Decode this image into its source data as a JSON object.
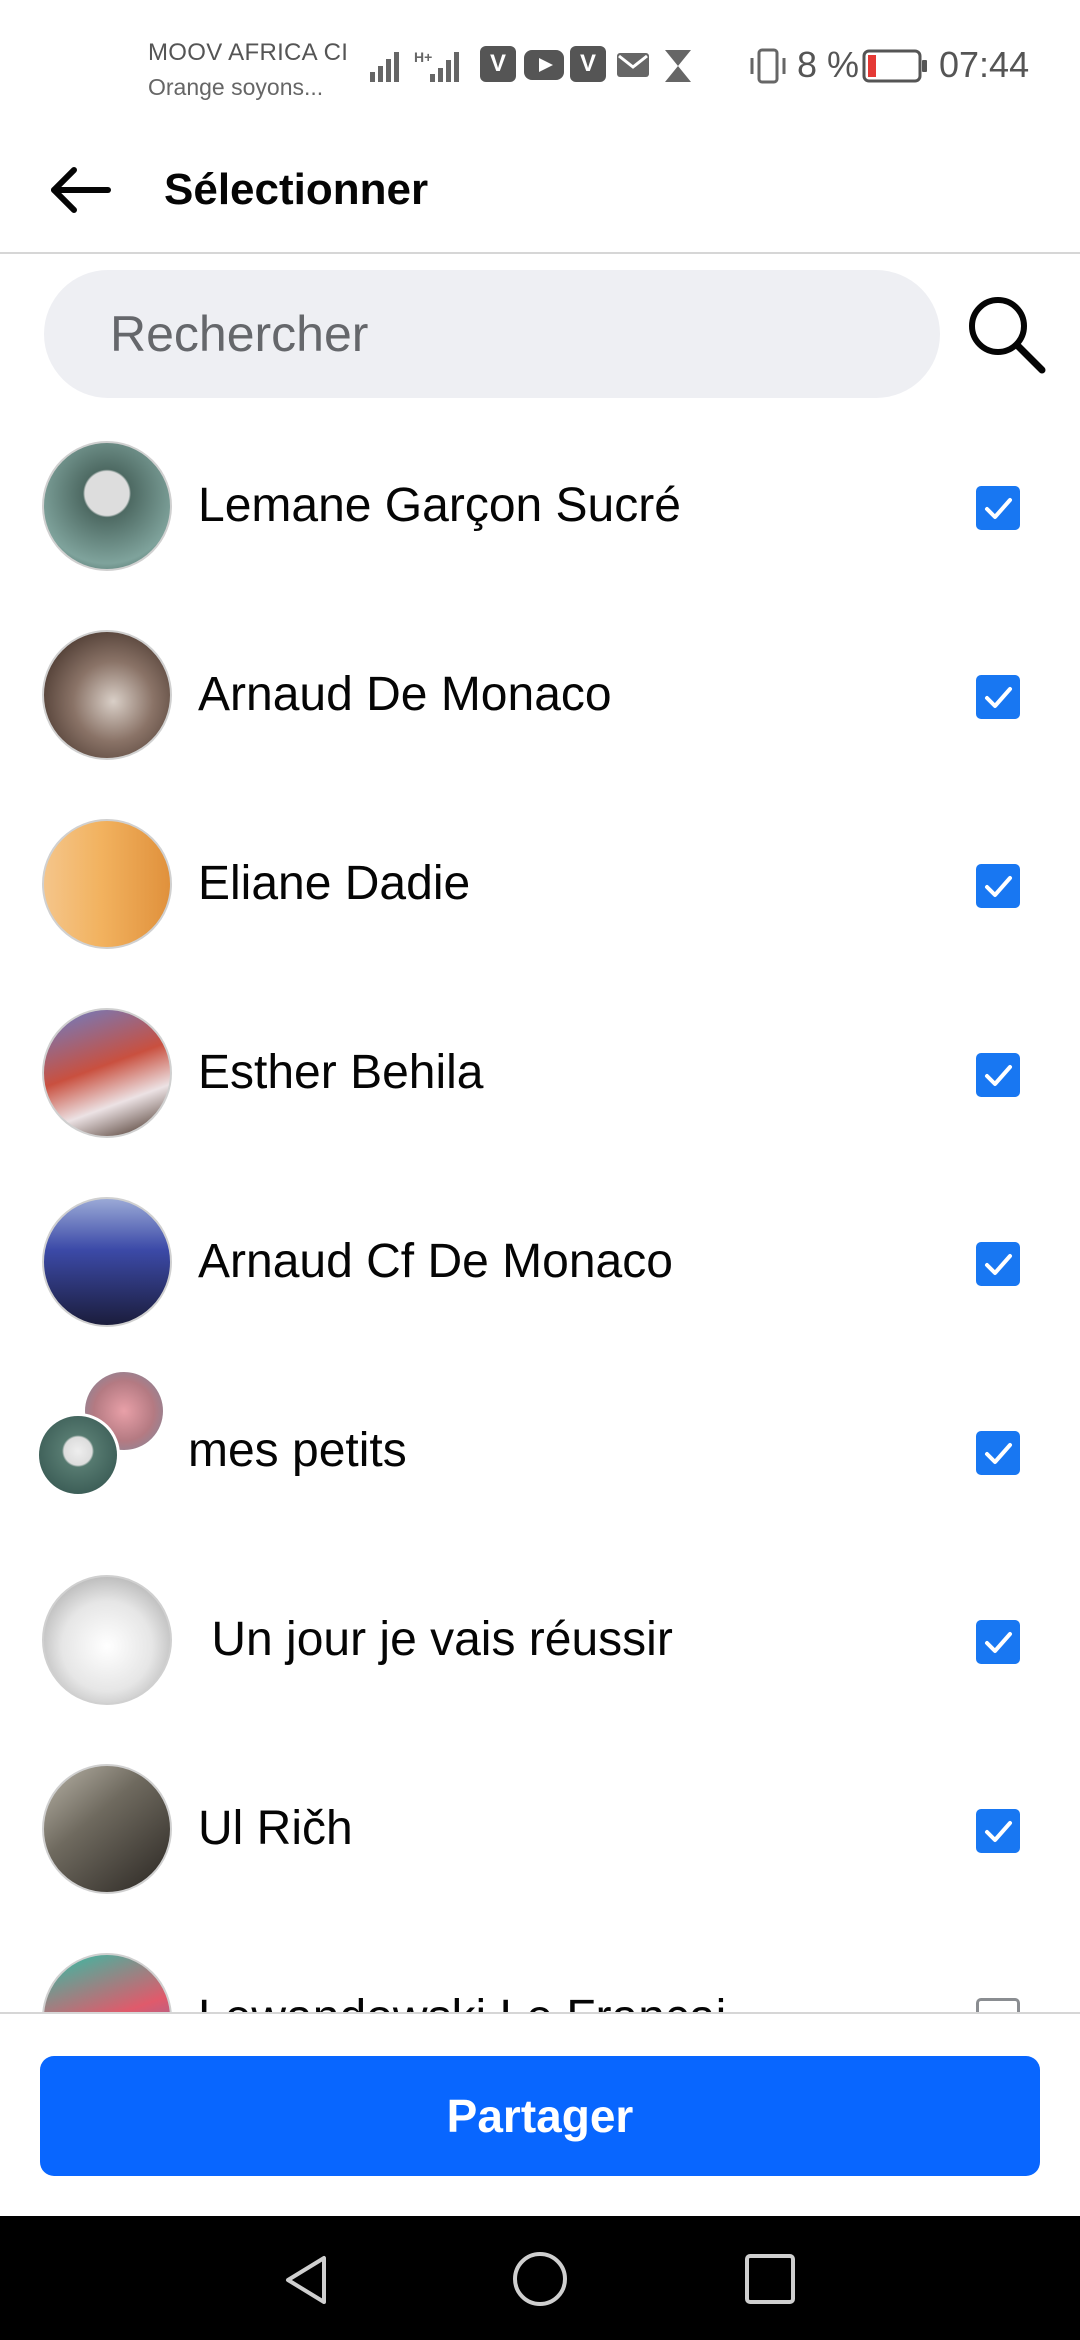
{
  "status_bar": {
    "carrier_line1": "MOOV AFRICA CI",
    "carrier_line2": "Orange soyons...",
    "battery_percent": "8 %",
    "battery_level": 0.08,
    "time": "07:44",
    "notification_icons": [
      "signal-icon",
      "signal-hplus-icon",
      "vivo-app-icon",
      "youtube-icon",
      "vivo-app-icon",
      "gmail-icon",
      "hourglass-icon"
    ]
  },
  "header": {
    "title": "Sélectionner",
    "back_icon": "arrow-left-icon"
  },
  "search": {
    "placeholder": "Rechercher",
    "value": "",
    "icon": "search-icon"
  },
  "contacts": [
    {
      "name": "Lemane Garçon Sucré",
      "checked": true
    },
    {
      "name": "Arnaud De Monaco",
      "checked": true
    },
    {
      "name": "Eliane Dadie",
      "checked": true
    },
    {
      "name": "Esther Behila",
      "checked": true
    },
    {
      "name": "Arnaud Cf De Monaco",
      "checked": true
    },
    {
      "name": "mes petits",
      "checked": true,
      "group": true
    },
    {
      "name": " Un jour je vais réussir",
      "checked": true
    },
    {
      "name": "Ul Rič̌h",
      "checked": true
    },
    {
      "name": "Lewandowski Le Françai",
      "checked": false
    }
  ],
  "share_button": {
    "label": "Partager"
  },
  "nav": {
    "back_icon": "triangle-back-icon",
    "home_icon": "circle-home-icon",
    "recents_icon": "square-recents-icon"
  },
  "colors": {
    "accent": "#1877f2",
    "share_button": "#0866ff",
    "search_bg": "#eeeff3",
    "text": "#050505",
    "placeholder": "#65676b"
  }
}
